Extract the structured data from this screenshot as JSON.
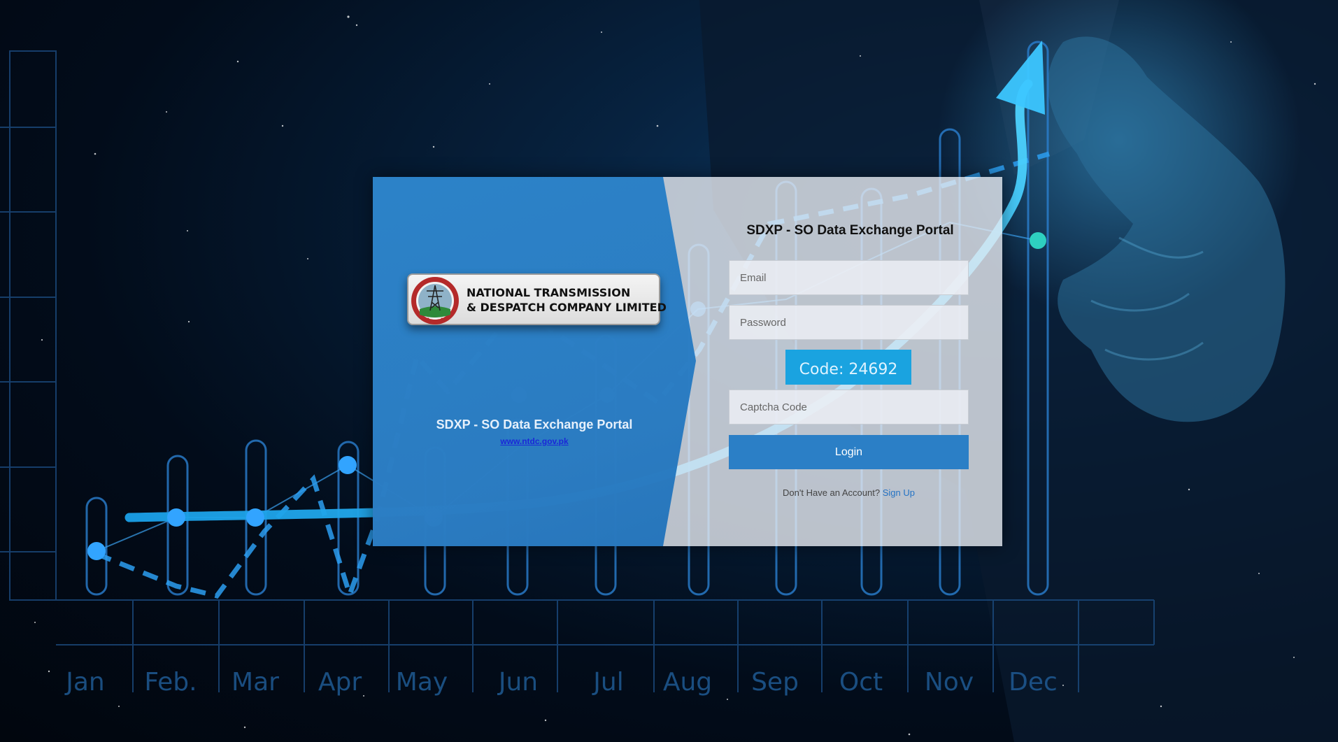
{
  "background": {
    "months": [
      "Jan",
      "Feb.",
      "Mar",
      "Apr",
      "May",
      "Jun",
      "Jul",
      "Aug",
      "Sep",
      "Oct",
      "Nov",
      "Dec"
    ]
  },
  "brand": {
    "company_line1": "NATIONAL TRANSMISSION",
    "company_line2": "& DESPATCH COMPANY LIMITED",
    "portal_title": "SDXP - SO Data Exchange Portal",
    "website_link": "www.ntdc.gov.pk"
  },
  "login": {
    "title": "SDXP - SO Data Exchange Portal",
    "email_placeholder": "Email",
    "password_placeholder": "Password",
    "captcha_label": "Code: 24692",
    "captcha_placeholder": "Captcha Code",
    "login_label": "Login",
    "signup_prompt": "Don't Have an Account?",
    "signup_link": "Sign Up"
  },
  "colors": {
    "primary_blue": "#2b7fc6",
    "captcha_bg": "#1aa3e0",
    "link_blue": "#1a28d8"
  }
}
